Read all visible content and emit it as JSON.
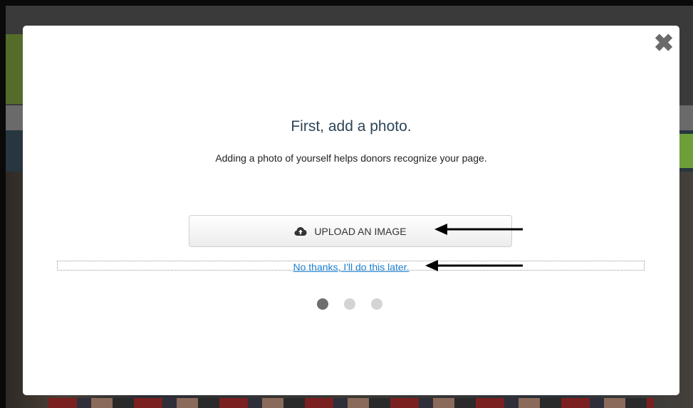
{
  "modal": {
    "title": "First, add a photo.",
    "subtitle": "Adding a photo of yourself helps donors recognize your page.",
    "upload_label": "UPLOAD AN IMAGE",
    "skip_label": "No thanks, I'll do this later.",
    "close_glyph": "✖",
    "steps": {
      "total": 3,
      "current": 1
    }
  },
  "icons": {
    "close": "close-icon",
    "upload": "cloud-upload-icon"
  },
  "colors": {
    "title": "#2e4558",
    "link": "#1a7fd0",
    "dot_active": "#6e6e6e",
    "dot_inactive": "#d4d4d4"
  }
}
